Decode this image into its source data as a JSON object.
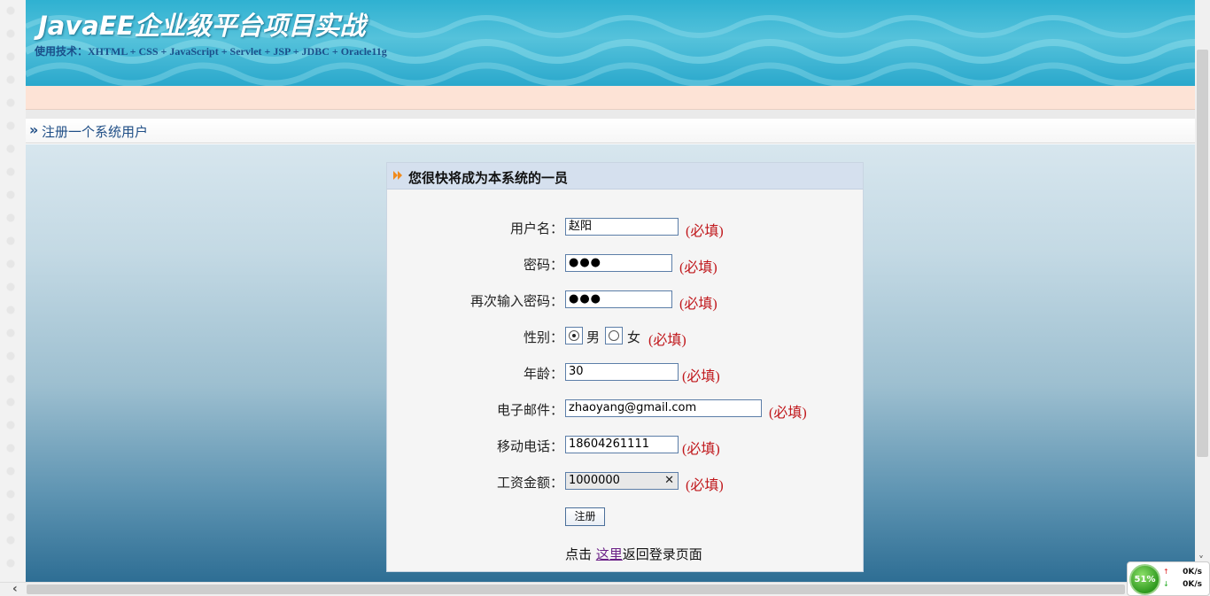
{
  "header": {
    "title": "JavaEE企业级平台项目实战",
    "subtitle": "使用技术：XHTML + CSS + JavaScript + Servlet + JSP + JDBC + Oracle11g"
  },
  "breadcrumb": {
    "arrow": "»",
    "text": "注册一个系统用户"
  },
  "panel": {
    "heading": "您很快将成为本系统的一员"
  },
  "form": {
    "username": {
      "label": "用户名：",
      "value": "赵阳",
      "required": "(必填)"
    },
    "password": {
      "label": "密码：",
      "value": "●●●",
      "required": "(必填)"
    },
    "password2": {
      "label": "再次输入密码：",
      "value": "●●●",
      "required": "(必填)"
    },
    "gender": {
      "label": "性别：",
      "option_male": "男",
      "option_female": "女",
      "selected": "男",
      "required": "(必填)"
    },
    "age": {
      "label": "年龄：",
      "value": "30",
      "required": "(必填)"
    },
    "email": {
      "label": "电子邮件：",
      "value": "zhaoyang@gmail.com",
      "required": "(必填)"
    },
    "mobile": {
      "label": "移动电话：",
      "value": "18604261111",
      "required": "(必填)"
    },
    "salary": {
      "label": "工资金额：",
      "value": "1000000",
      "clear": "✕",
      "required": "(必填)"
    },
    "submit_label": "注册"
  },
  "back": {
    "prefix": "点击 ",
    "link": "这里",
    "suffix": "返回登录页面"
  },
  "net_monitor": {
    "percent": "51%",
    "up_speed": "0K/s",
    "down_speed": "0K/s"
  },
  "colors": {
    "banner": "#2fb1d1",
    "required": "#c0171b",
    "link": "#6a1f86",
    "breadcrumb": "#1f4e86"
  }
}
